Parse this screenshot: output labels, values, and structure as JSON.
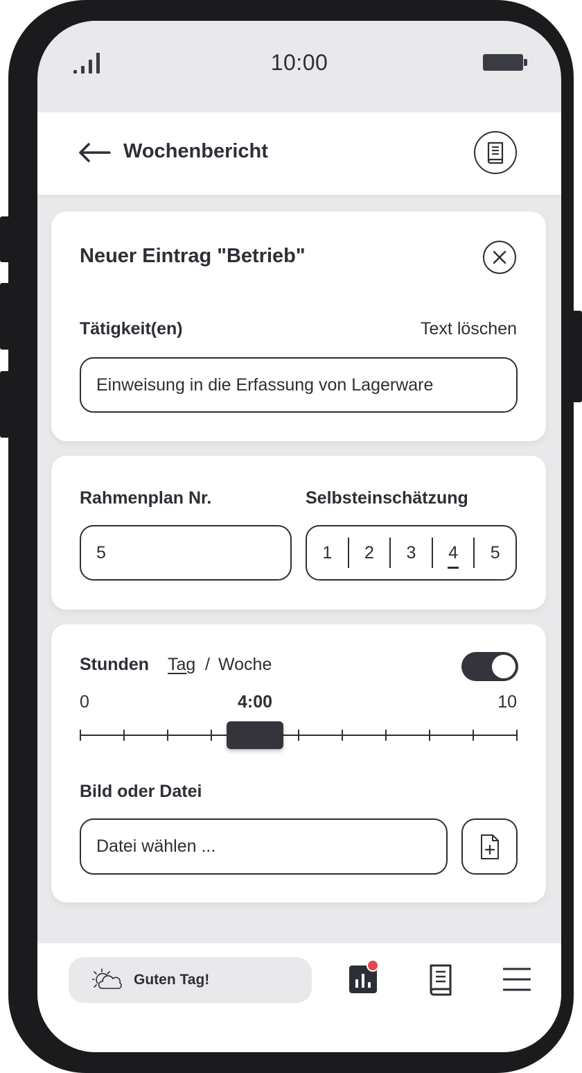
{
  "status_bar": {
    "time": "10:00"
  },
  "header": {
    "title": "Wochenbericht"
  },
  "entry_card": {
    "title": "Neuer Eintrag \"Betrieb\"",
    "activity_label": "Tätigkeit(en)",
    "clear_text_label": "Text löschen",
    "activity_value": "Einweisung in die Erfassung von Lagerware"
  },
  "plan_card": {
    "plan_label": "Rahmenplan Nr.",
    "plan_value": "5",
    "self_assessment_label": "Selbsteinschätzung",
    "rating_options": [
      "1",
      "2",
      "3",
      "4",
      "5"
    ],
    "rating_selected": "4"
  },
  "hours_card": {
    "hours_label": "Stunden",
    "mode_day": "Tag",
    "mode_separator": "/",
    "mode_week": "Woche",
    "toggle_on": true,
    "scale_min": "0",
    "scale_max": "10",
    "slider_value_label": "4:00",
    "slider": {
      "min": 0,
      "max": 10,
      "value": 4
    },
    "file_label": "Bild oder Datei",
    "file_placeholder": "Datei wählen ..."
  },
  "bottom_nav": {
    "greeting": "Guten Tag!",
    "stats_has_notification": true,
    "notification_color": "#e5484d"
  },
  "colors": {
    "ink": "#2d2f36",
    "frame": "#1b1b1e",
    "background": "#e9e9eb",
    "surface": "#ffffff"
  }
}
